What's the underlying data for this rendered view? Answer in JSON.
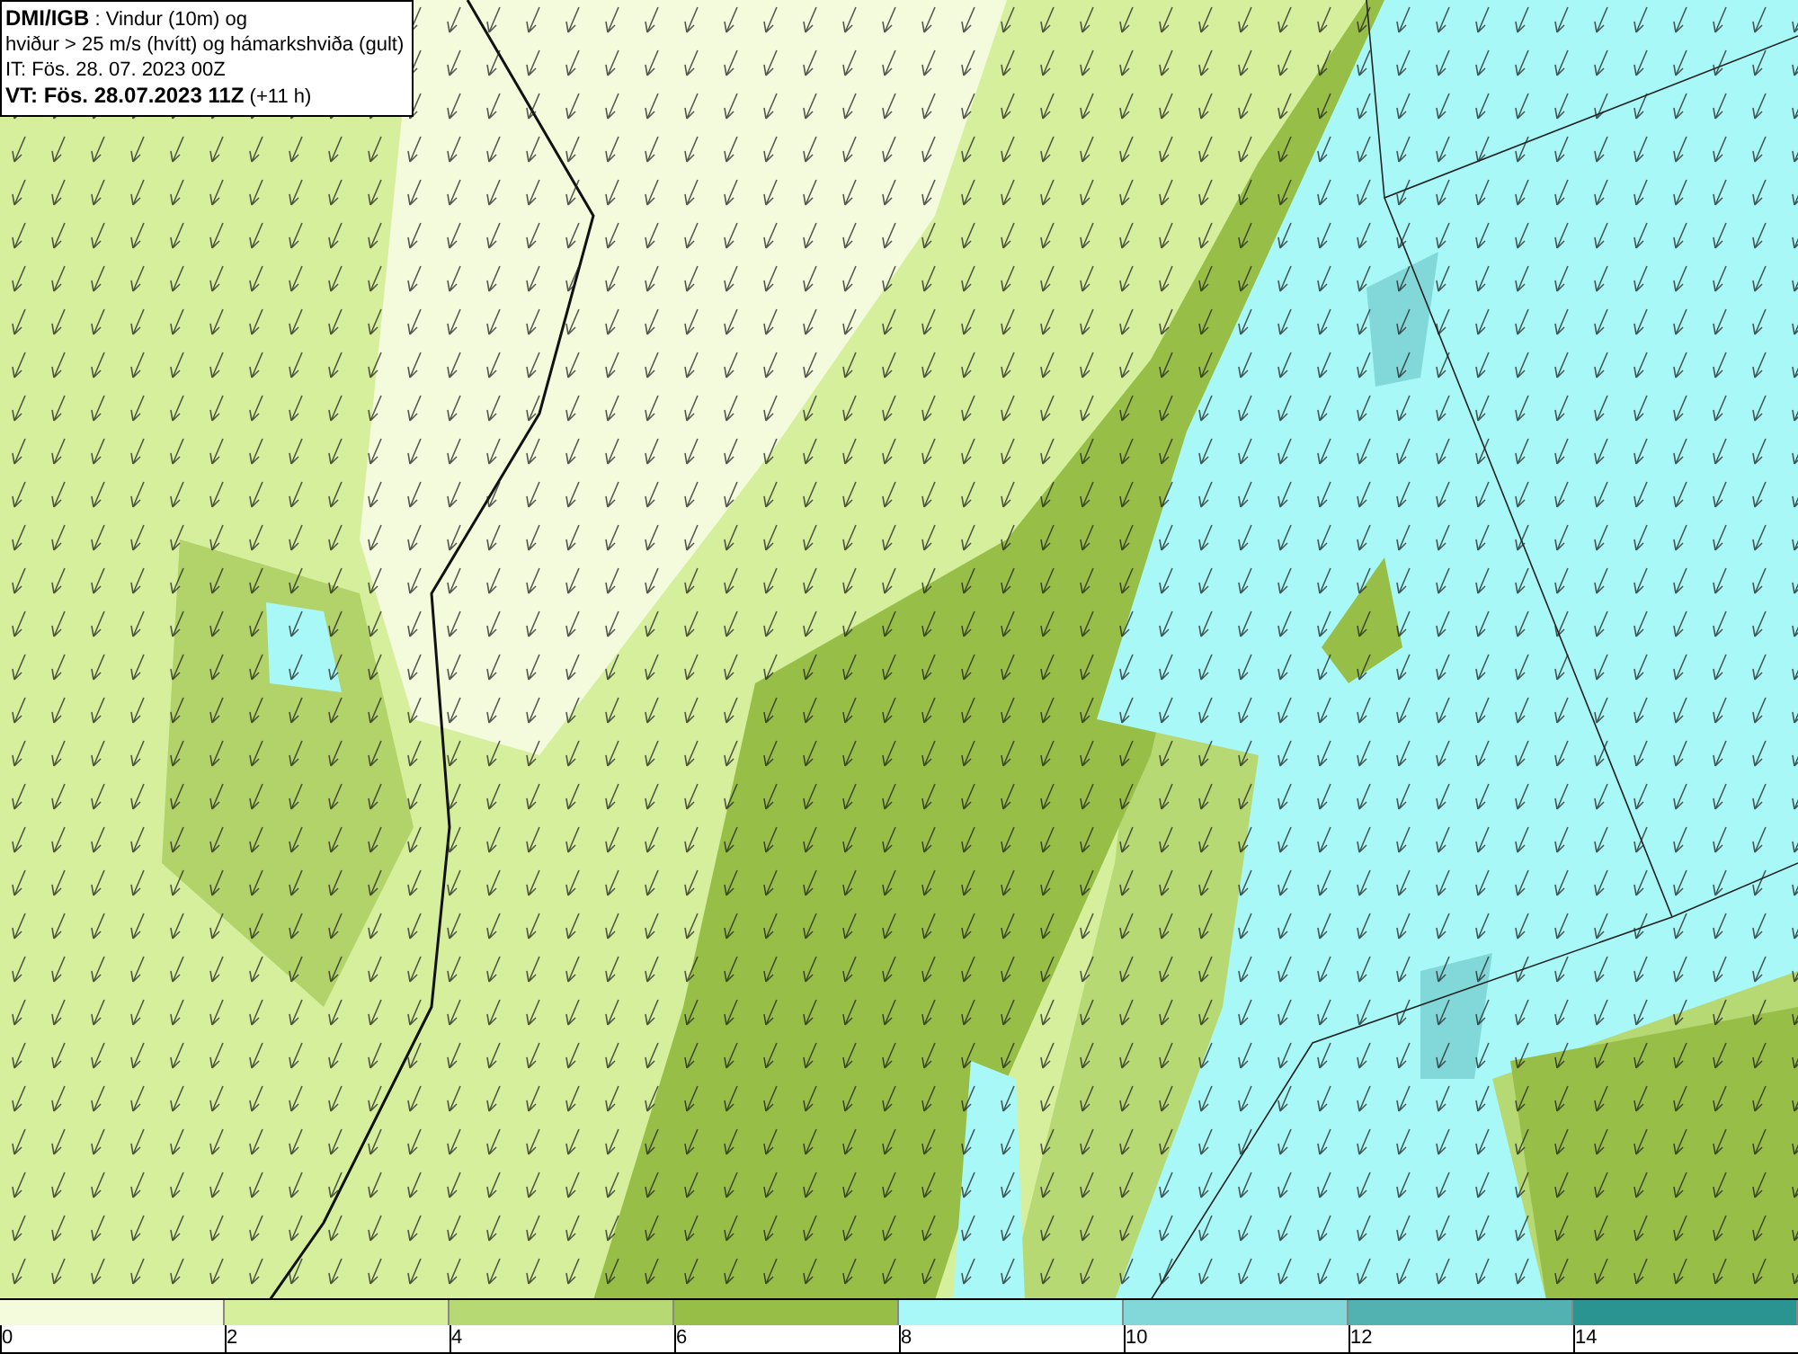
{
  "title_box": {
    "lines": [
      "**DMI/IGB** : Vindur (10m) og",
      "hviður > 25 m/s (hvítt) og hámarkshviða (gult)",
      "IT: Fös. 28. 07. 2023 00Z",
      "**VT: Fös. 28.07.2023 11Z** (+11 h)"
    ]
  },
  "legend": {
    "segments": [
      {
        "color": "#f4fadc",
        "label": "0"
      },
      {
        "color": "#d6ef9c",
        "label": "2"
      },
      {
        "color": "#b6d974",
        "label": "4"
      },
      {
        "color": "#97bf48",
        "label": "6"
      },
      {
        "color": "#a8f8f8",
        "label": "8"
      },
      {
        "color": "#82d8d8",
        "label": "10"
      },
      {
        "color": "#52b2b2",
        "label": "12"
      },
      {
        "color": "#2a9490",
        "label": "14"
      }
    ]
  }
}
